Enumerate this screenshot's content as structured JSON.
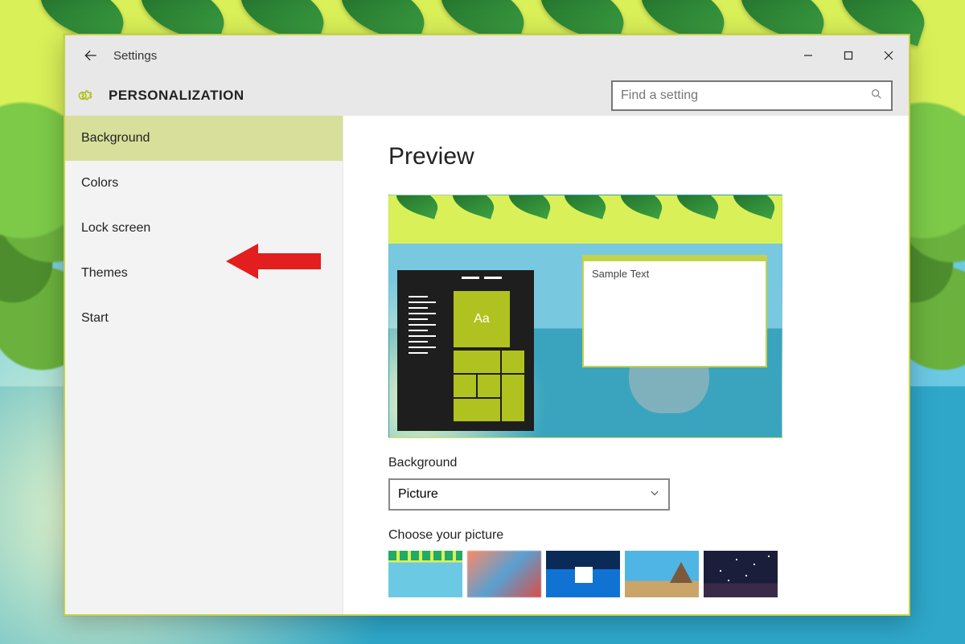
{
  "titlebar": {
    "title": "Settings"
  },
  "header": {
    "section": "PERSONALIZATION",
    "search_placeholder": "Find a setting"
  },
  "sidebar": {
    "items": [
      {
        "label": "Background",
        "selected": true
      },
      {
        "label": "Colors",
        "selected": false
      },
      {
        "label": "Lock screen",
        "selected": false
      },
      {
        "label": "Themes",
        "selected": false
      },
      {
        "label": "Start",
        "selected": false
      }
    ]
  },
  "content": {
    "preview_heading": "Preview",
    "preview_tile_text": "Aa",
    "preview_sticky_text": "Sample Text",
    "background_label": "Background",
    "background_value": "Picture",
    "choose_picture_label": "Choose your picture"
  },
  "annotation": {
    "arrow_points_to": "Lock screen"
  }
}
